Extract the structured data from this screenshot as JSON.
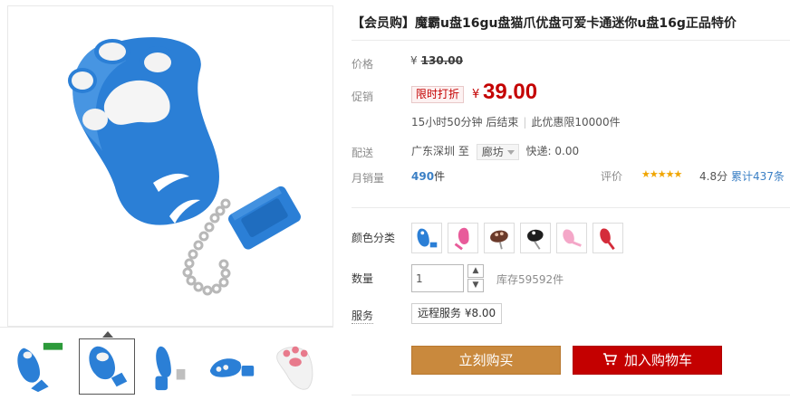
{
  "title": "【会员购】魔霸u盘16gu盘猫爪优盘可爱卡通迷你u盘16g正品特价",
  "price": {
    "label": "价格",
    "currency": "¥",
    "original": "130.00"
  },
  "promo": {
    "label": "促销",
    "badge": "限时打折",
    "currency": "¥",
    "price": "39.00",
    "countdown": "15小时50分钟 后结束",
    "limit": "此优惠限10000件"
  },
  "shipping": {
    "label": "配送",
    "origin": "广东深圳",
    "to": "至",
    "destination": "廊坊",
    "express": "快递: 0.00"
  },
  "sales": {
    "label": "月销量",
    "count": "490",
    "unit": "件",
    "rating_label": "评价",
    "stars": "★★★★★",
    "score": "4.8分",
    "review_count": "累计437条"
  },
  "color": {
    "label": "颜色分类",
    "options": [
      "blue",
      "pink",
      "brown",
      "black",
      "light-pink",
      "red"
    ]
  },
  "quantity": {
    "label": "数量",
    "value": "1",
    "stock": "库存59592件"
  },
  "service": {
    "label": "服务",
    "chip": "远程服务 ¥8.00"
  },
  "actions": {
    "buy": "立刻购买",
    "cart": "加入购物车"
  },
  "colors": {
    "accent_red": "#c40000",
    "buy_orange": "#c9893d",
    "link_blue": "#3a7fc5",
    "product_blue": "#2b7fd6"
  },
  "thumbnails": [
    "thumb-1",
    "thumb-2",
    "thumb-3",
    "thumb-4",
    "thumb-5"
  ]
}
